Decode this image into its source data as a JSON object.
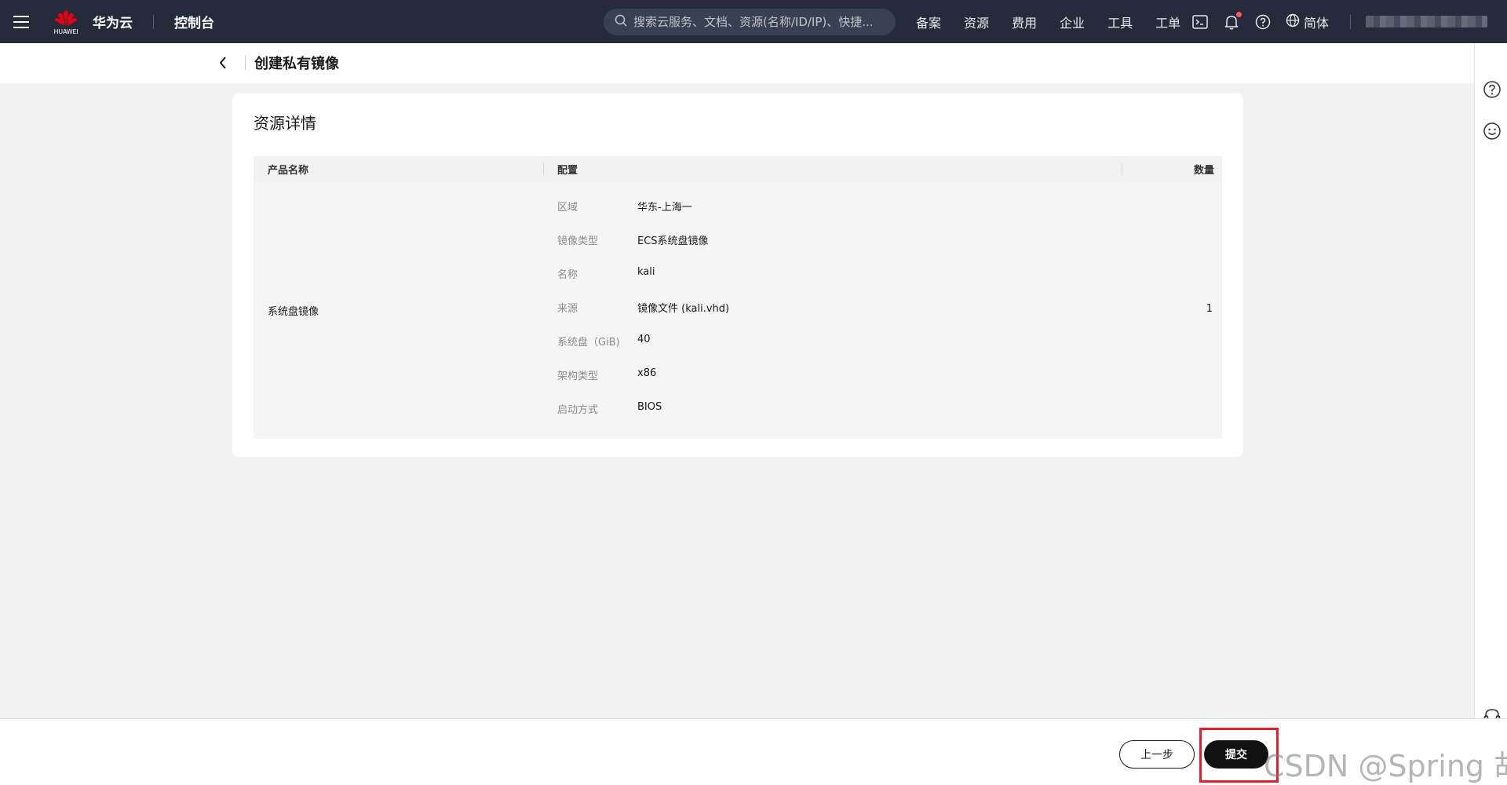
{
  "topbar": {
    "brand_small": "HUAWEI",
    "brand": "华为云",
    "console": "控制台",
    "search_placeholder": "搜索云服务、文档、资源(名称/ID/IP)、快捷...",
    "nav": [
      "备案",
      "资源",
      "费用",
      "企业",
      "工具",
      "工单"
    ],
    "lang": "简体",
    "colors": {
      "bg": "#252b3a",
      "notify": "#ff5b5b"
    }
  },
  "subheader": {
    "title": "创建私有镜像"
  },
  "card": {
    "title": "资源详情",
    "columns": [
      "产品名称",
      "配置",
      "数量"
    ],
    "row": {
      "product": "系统盘镜像",
      "quantity": "1",
      "config": [
        {
          "key": "区域",
          "value": "华东-上海一"
        },
        {
          "key": "镜像类型",
          "value": "ECS系统盘镜像"
        },
        {
          "key": "名称",
          "value": "kali"
        },
        {
          "key": "来源",
          "value": "镜像文件 (kali.vhd)"
        },
        {
          "key": "系统盘（GiB)",
          "value": "40"
        },
        {
          "key": "架构类型",
          "value": "x86"
        },
        {
          "key": "启动方式",
          "value": "BIOS"
        }
      ]
    }
  },
  "footer": {
    "prev_label": "上一步",
    "submit_label": "提交",
    "highlight_color": "#e0202a"
  },
  "watermark": "CSDN @Spring  胡"
}
